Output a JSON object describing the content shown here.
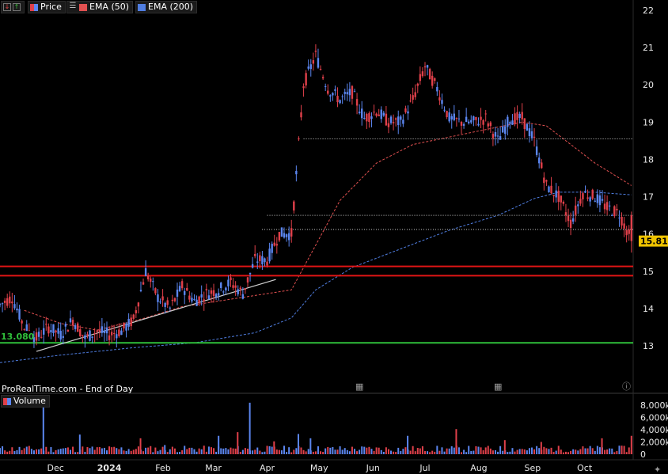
{
  "legend": {
    "price": "Price",
    "ema50": "EMA (50)",
    "ema200": "EMA (200)",
    "volume": "Volume"
  },
  "branding": "ProRealTime.com - End of Day",
  "icons": [
    "arrow-down-icon",
    "arrow-up-icon",
    "candle-icon",
    "settings-icon",
    "calendar-icon",
    "info-icon",
    "wrench-icon"
  ],
  "colors": {
    "up": "#5b86f0",
    "down": "#e0404a",
    "ema50": "#e05050",
    "ema200": "#4f7de0",
    "support": "#2fbf3a",
    "resistance": "#e01515",
    "trend": "#cfcfcf",
    "background": "#000000"
  },
  "chart_data": [
    {
      "type": "candlestick",
      "title": "",
      "last_price": "15.810",
      "level_label": "13.080",
      "y_ticks": [
        13,
        14,
        15,
        16,
        17,
        18,
        19,
        20,
        21,
        22
      ],
      "ylim": [
        12.55,
        22.25
      ],
      "x_ticks": [
        "Dec",
        "2024",
        "Feb",
        "Mar",
        "Apr",
        "May",
        "Jun",
        "Jul",
        "Aug",
        "Sep",
        "Oct"
      ],
      "x_tick_dates": [
        "2023-12-01",
        "2024-01-01",
        "2024-02-01",
        "2024-03-01",
        "2024-04-01",
        "2024-05-01",
        "2024-06-01",
        "2024-07-01",
        "2024-08-01",
        "2024-09-01",
        "2024-10-01"
      ],
      "xlim": [
        "2023-10-30",
        "2024-10-29"
      ],
      "horizontal_lines": [
        {
          "value": 15.13,
          "color": "red"
        },
        {
          "value": 14.88,
          "color": "red"
        },
        {
          "value": 13.08,
          "color": "green"
        },
        {
          "value": 18.55,
          "style": "dotted",
          "from": "2024-04-22"
        },
        {
          "value": 16.5,
          "style": "dotted",
          "from": "2024-04-01"
        },
        {
          "value": 16.12,
          "style": "dotted",
          "from": "2024-03-29"
        }
      ],
      "trendline": {
        "from": [
          "2023-11-20",
          12.85
        ],
        "to": [
          "2024-04-06",
          14.78
        ]
      },
      "close_series": [
        [
          "2023-10-30",
          14.1
        ],
        [
          "2023-11-06",
          14.3
        ],
        [
          "2023-11-13",
          13.5
        ],
        [
          "2023-11-20",
          13.2
        ],
        [
          "2023-11-27",
          13.5
        ],
        [
          "2023-12-04",
          13.3
        ],
        [
          "2023-12-11",
          13.7
        ],
        [
          "2023-12-18",
          13.2
        ],
        [
          "2023-12-25",
          13.4
        ],
        [
          "2024-01-01",
          13.3
        ],
        [
          "2024-01-08",
          13.4
        ],
        [
          "2024-01-15",
          13.7
        ],
        [
          "2024-01-22",
          15.0
        ],
        [
          "2024-01-29",
          14.3
        ],
        [
          "2024-02-05",
          14.0
        ],
        [
          "2024-02-12",
          14.6
        ],
        [
          "2024-02-19",
          14.2
        ],
        [
          "2024-02-26",
          14.4
        ],
        [
          "2024-03-04",
          14.5
        ],
        [
          "2024-03-11",
          14.7
        ],
        [
          "2024-03-18",
          14.4
        ],
        [
          "2024-03-25",
          15.3
        ],
        [
          "2024-04-01",
          15.3
        ],
        [
          "2024-04-08",
          16.0
        ],
        [
          "2024-04-15",
          16.0
        ],
        [
          "2024-04-22",
          20.0
        ],
        [
          "2024-04-29",
          20.8
        ],
        [
          "2024-05-06",
          19.9
        ],
        [
          "2024-05-13",
          19.6
        ],
        [
          "2024-05-20",
          19.8
        ],
        [
          "2024-05-27",
          19.1
        ],
        [
          "2024-06-03",
          19.3
        ],
        [
          "2024-06-10",
          19.0
        ],
        [
          "2024-06-17",
          19.0
        ],
        [
          "2024-06-24",
          19.6
        ],
        [
          "2024-07-01",
          20.5
        ],
        [
          "2024-07-08",
          19.9
        ],
        [
          "2024-07-15",
          19.1
        ],
        [
          "2024-07-22",
          19.0
        ],
        [
          "2024-07-29",
          19.0
        ],
        [
          "2024-08-05",
          19.1
        ],
        [
          "2024-08-12",
          18.5
        ],
        [
          "2024-08-19",
          19.1
        ],
        [
          "2024-08-26",
          19.1
        ],
        [
          "2024-09-02",
          18.5
        ],
        [
          "2024-09-09",
          17.3
        ],
        [
          "2024-09-16",
          17.0
        ],
        [
          "2024-09-23",
          16.3
        ],
        [
          "2024-09-30",
          17.1
        ],
        [
          "2024-10-07",
          17.0
        ],
        [
          "2024-10-14",
          16.7
        ],
        [
          "2024-10-21",
          16.55
        ],
        [
          "2024-10-28",
          15.81
        ]
      ],
      "ema50": [
        [
          "2023-11-13",
          13.95
        ],
        [
          "2023-12-04",
          13.6
        ],
        [
          "2023-12-25",
          13.42
        ],
        [
          "2024-01-22",
          13.75
        ],
        [
          "2024-02-12",
          14.05
        ],
        [
          "2024-03-04",
          14.2
        ],
        [
          "2024-03-25",
          14.35
        ],
        [
          "2024-04-15",
          14.5
        ],
        [
          "2024-04-29",
          15.7
        ],
        [
          "2024-05-13",
          16.9
        ],
        [
          "2024-06-03",
          17.9
        ],
        [
          "2024-06-24",
          18.4
        ],
        [
          "2024-07-15",
          18.6
        ],
        [
          "2024-08-05",
          18.8
        ],
        [
          "2024-08-26",
          19.0
        ],
        [
          "2024-09-09",
          18.9
        ],
        [
          "2024-09-23",
          18.4
        ],
        [
          "2024-10-07",
          17.9
        ],
        [
          "2024-10-28",
          17.3
        ]
      ],
      "ema200": [
        [
          "2023-10-30",
          12.55
        ],
        [
          "2023-12-04",
          12.75
        ],
        [
          "2024-01-15",
          12.95
        ],
        [
          "2024-02-19",
          13.08
        ],
        [
          "2024-03-25",
          13.35
        ],
        [
          "2024-04-15",
          13.75
        ],
        [
          "2024-04-29",
          14.5
        ],
        [
          "2024-05-20",
          15.1
        ],
        [
          "2024-06-17",
          15.6
        ],
        [
          "2024-07-15",
          16.1
        ],
        [
          "2024-08-12",
          16.5
        ],
        [
          "2024-09-02",
          16.95
        ],
        [
          "2024-09-16",
          17.12
        ],
        [
          "2024-10-07",
          17.12
        ],
        [
          "2024-10-28",
          17.05
        ]
      ]
    },
    {
      "type": "bar",
      "title": "Volume",
      "y_ticks": [
        "8,000k",
        "6,000k",
        "4,000k",
        "2,000k",
        "0"
      ],
      "ylim": [
        0,
        8800
      ],
      "spikes": [
        [
          "2023-11-24",
          7800,
          "up"
        ],
        [
          "2023-12-15",
          3200,
          "up"
        ],
        [
          "2024-01-19",
          2600,
          "down"
        ],
        [
          "2024-02-02",
          1500,
          "up"
        ],
        [
          "2024-03-04",
          3000,
          "up"
        ],
        [
          "2024-03-15",
          3600,
          "down"
        ],
        [
          "2024-03-22",
          8400,
          "up"
        ],
        [
          "2024-04-05",
          2100,
          "down"
        ],
        [
          "2024-04-19",
          3300,
          "up"
        ],
        [
          "2024-04-26",
          2600,
          "up"
        ],
        [
          "2024-06-21",
          3000,
          "up"
        ],
        [
          "2024-07-19",
          4100,
          "down"
        ],
        [
          "2024-08-16",
          2300,
          "down"
        ],
        [
          "2024-09-06",
          2000,
          "down"
        ],
        [
          "2024-10-11",
          2600,
          "down"
        ],
        [
          "2024-10-28",
          3000,
          "down"
        ]
      ]
    }
  ]
}
